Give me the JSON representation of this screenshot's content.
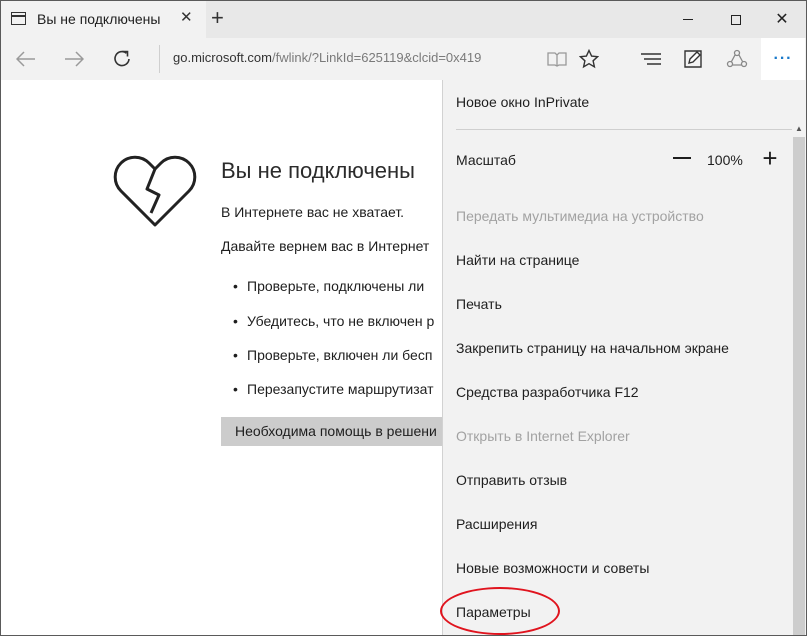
{
  "tab": {
    "title": "Вы не подключены",
    "close": "✕"
  },
  "window_controls": {
    "close": "✕"
  },
  "address": {
    "host": "go.microsoft.com",
    "path": "/fwlink/?LinkId=625119&clcid=0x419"
  },
  "more_button": "···",
  "page": {
    "title": "Вы не подключены",
    "line1": "В Интернете вас не хватает.",
    "line2": "Давайте вернем вас в Интернет",
    "bullets": [
      "Проверьте, подключены ли",
      "Убедитесь, что не включен р",
      "Проверьте, включен ли бесп",
      "Перезапустите маршрутизат"
    ],
    "help_button": "Необходима помощь в решени"
  },
  "menu": {
    "items": [
      {
        "label": "Новое окно InPrivate",
        "disabled": false
      },
      {
        "label": "Масштаб",
        "disabled": false
      },
      {
        "label": "Передать мультимедиа на устройство",
        "disabled": true
      },
      {
        "label": "Найти на странице",
        "disabled": false
      },
      {
        "label": "Печать",
        "disabled": false
      },
      {
        "label": "Закрепить страницу на начальном экране",
        "disabled": false
      },
      {
        "label": "Средства разработчика F12",
        "disabled": false
      },
      {
        "label": "Открыть в Internet Explorer",
        "disabled": true
      },
      {
        "label": "Отправить отзыв",
        "disabled": false
      },
      {
        "label": "Расширения",
        "disabled": false
      },
      {
        "label": "Новые возможности и советы",
        "disabled": false
      },
      {
        "label": "Параметры",
        "disabled": false
      }
    ],
    "zoom": {
      "value": "100%",
      "minus": "—",
      "plus": "+"
    }
  },
  "colors": {
    "accent": "#1979ca",
    "highlight": "#e0141e"
  }
}
